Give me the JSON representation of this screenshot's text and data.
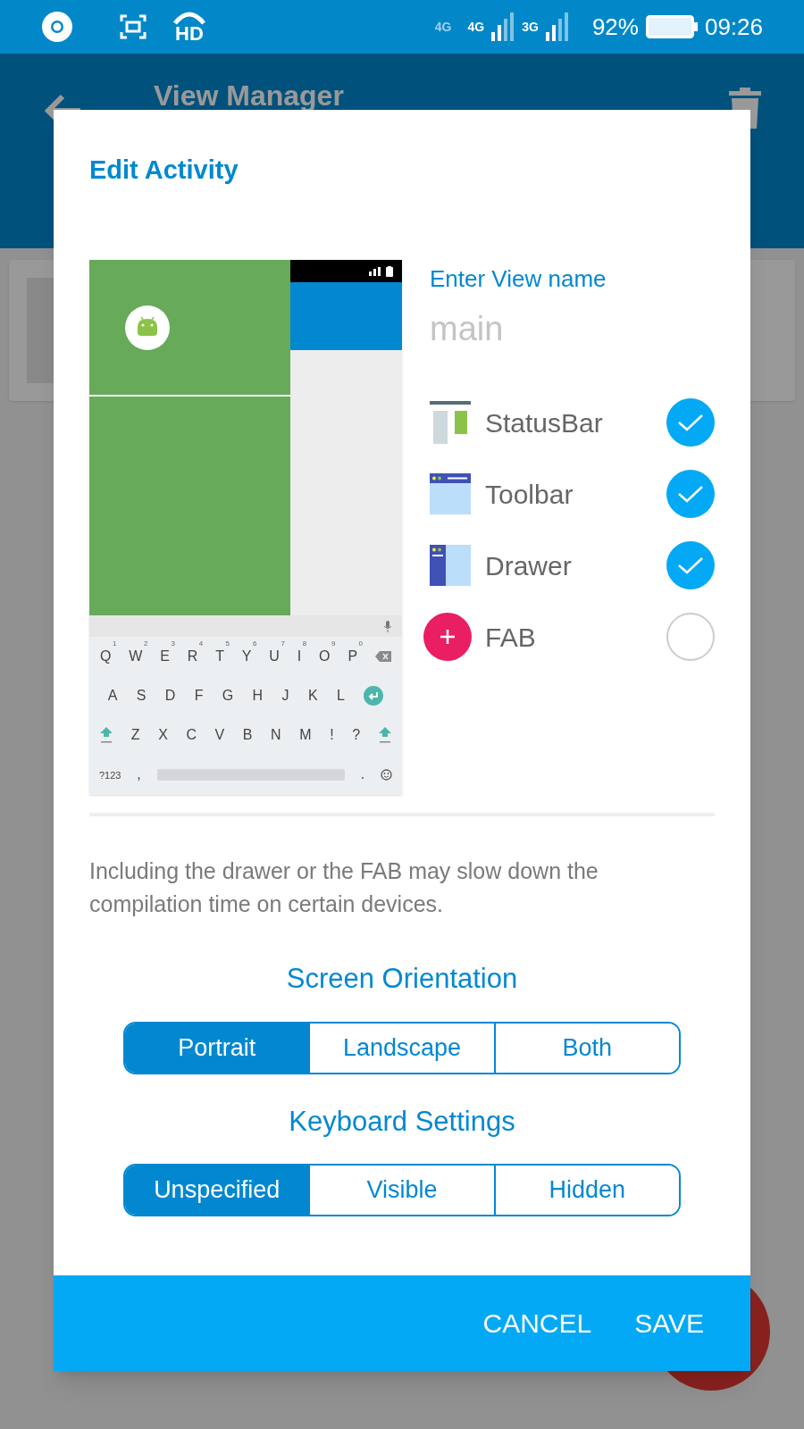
{
  "status_bar": {
    "network_labels": [
      "4G",
      "4G",
      "3G"
    ],
    "hd_label": "HD",
    "battery": "92%",
    "time": "09:26"
  },
  "app_bar": {
    "title": "View Manager"
  },
  "dialog": {
    "title": "Edit Activity",
    "preview": {
      "keyboard": {
        "rows": [
          [
            {
              "kind": "char",
              "label": "Q",
              "hint": "1"
            },
            {
              "kind": "char",
              "label": "W",
              "hint": "2"
            },
            {
              "kind": "char",
              "label": "E",
              "hint": "3"
            },
            {
              "kind": "char",
              "label": "R",
              "hint": "4"
            },
            {
              "kind": "char",
              "label": "T",
              "hint": "5"
            },
            {
              "kind": "char",
              "label": "Y",
              "hint": "6"
            },
            {
              "kind": "char",
              "label": "U",
              "hint": "7"
            },
            {
              "kind": "char",
              "label": "I",
              "hint": "8"
            },
            {
              "kind": "char",
              "label": "O",
              "hint": "9"
            },
            {
              "kind": "char",
              "label": "P",
              "hint": "0"
            },
            {
              "kind": "backspace"
            }
          ],
          [
            {
              "kind": "char",
              "label": "A"
            },
            {
              "kind": "char",
              "label": "S"
            },
            {
              "kind": "char",
              "label": "D"
            },
            {
              "kind": "char",
              "label": "F"
            },
            {
              "kind": "char",
              "label": "G"
            },
            {
              "kind": "char",
              "label": "H"
            },
            {
              "kind": "char",
              "label": "J"
            },
            {
              "kind": "char",
              "label": "K"
            },
            {
              "kind": "char",
              "label": "L"
            },
            {
              "kind": "enter"
            }
          ],
          [
            {
              "kind": "shift"
            },
            {
              "kind": "char",
              "label": "Z"
            },
            {
              "kind": "char",
              "label": "X"
            },
            {
              "kind": "char",
              "label": "C"
            },
            {
              "kind": "char",
              "label": "V"
            },
            {
              "kind": "char",
              "label": "B"
            },
            {
              "kind": "char",
              "label": "N"
            },
            {
              "kind": "char",
              "label": "M"
            },
            {
              "kind": "char",
              "label": "!"
            },
            {
              "kind": "char",
              "label": "?"
            },
            {
              "kind": "shift"
            }
          ],
          [
            {
              "kind": "char",
              "label": "?123"
            },
            {
              "kind": "char",
              "label": ","
            },
            {
              "kind": "space"
            },
            {
              "kind": "char",
              "label": "."
            },
            {
              "kind": "emoji"
            }
          ]
        ]
      }
    },
    "name_field": {
      "label": "Enter View name",
      "placeholder": "main"
    },
    "options": [
      {
        "kind": "statusbar",
        "label": "StatusBar",
        "checked": true
      },
      {
        "kind": "toolbar",
        "label": "Toolbar",
        "checked": true
      },
      {
        "kind": "drawer",
        "label": "Drawer",
        "checked": true
      },
      {
        "kind": "fab",
        "label": "FAB",
        "checked": false
      }
    ],
    "notice": "Including the drawer or the FAB may slow down the compilation time on certain devices.",
    "groups": [
      {
        "title": "Screen Orientation",
        "segments": [
          {
            "label": "Portrait",
            "selected": true
          },
          {
            "label": "Landscape",
            "selected": false
          },
          {
            "label": "Both",
            "selected": false
          }
        ]
      },
      {
        "title": "Keyboard Settings",
        "segments": [
          {
            "label": "Unspecified",
            "selected": true
          },
          {
            "label": "Visible",
            "selected": false
          },
          {
            "label": "Hidden",
            "selected": false
          }
        ]
      }
    ],
    "buttons": [
      "CANCEL",
      "SAVE"
    ]
  }
}
